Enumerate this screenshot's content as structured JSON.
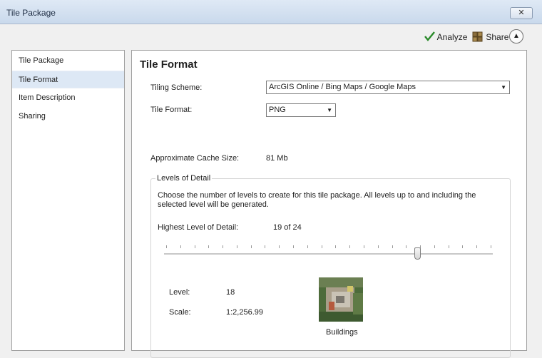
{
  "window": {
    "title": "Tile Package",
    "close_symbol": "✕"
  },
  "toolbar": {
    "analyze_label": "Analyze",
    "share_label": "Share"
  },
  "sidebar": {
    "items": [
      {
        "label": "Tile Package"
      },
      {
        "label": "Tile Format"
      },
      {
        "label": "Item Description"
      },
      {
        "label": "Sharing"
      }
    ]
  },
  "main": {
    "title": "Tile Format",
    "tiling_scheme_label": "Tiling Scheme:",
    "tiling_scheme_value": "ArcGIS Online / Bing Maps / Google Maps",
    "tile_format_label": "Tile Format:",
    "tile_format_value": "PNG",
    "cache_size_label": "Approximate Cache Size:",
    "cache_size_value": "81 Mb",
    "levels": {
      "group_title": "Levels of Detail",
      "instructions_line1": "Choose the number of levels to create for this tile package.   All levels up to and including the",
      "instructions_line2": "selected level will be generated.",
      "highest_label": "Highest Level of Detail:",
      "highest_value": "19 of 24",
      "slider_level": 19,
      "slider_max": 24,
      "level_label": "Level:",
      "level_value": "18",
      "scale_label": "Scale:",
      "scale_value": "1:2,256.99",
      "thumbnail_caption": "Buildings"
    }
  },
  "colors": {
    "checkmark": "#2a8a2a",
    "selected_item": "#dde8f5"
  }
}
